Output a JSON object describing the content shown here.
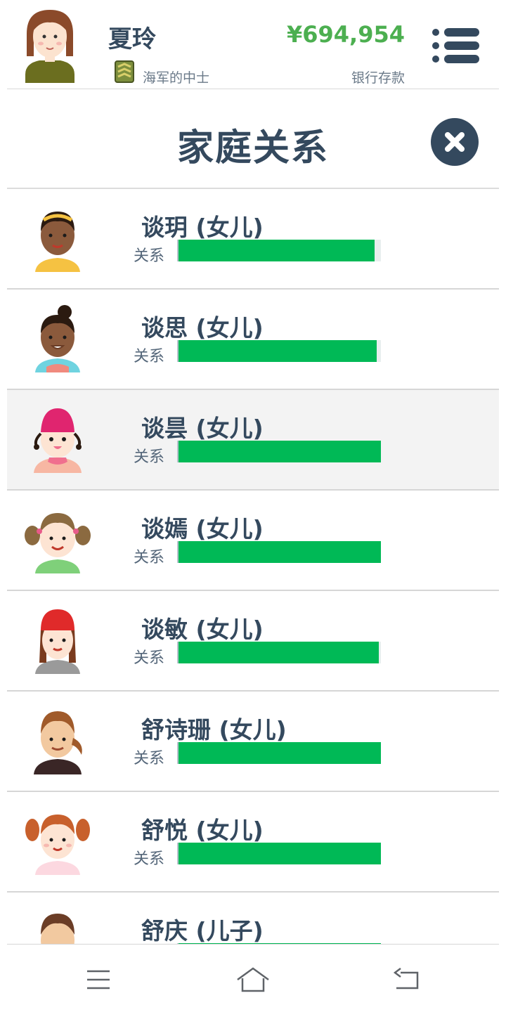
{
  "header": {
    "player_name": "夏玲",
    "rank": "海军的中士",
    "money": "¥694,954",
    "money_label": "银行存款",
    "menu_icon": "list-menu-icon"
  },
  "page": {
    "title": "家庭关系",
    "close_icon": "close-icon"
  },
  "family": [
    {
      "name": "谈玥 (女儿)",
      "relation_label": "关系",
      "relation": 0.97,
      "avatar": "girl-dark-headband-avatar"
    },
    {
      "name": "谈思 (女儿)",
      "relation_label": "关系",
      "relation": 0.98,
      "avatar": "girl-dark-bun-avatar"
    },
    {
      "name": "谈昙 (女儿)",
      "relation_label": "关系",
      "relation": 1.0,
      "avatar": "girl-pink-hat-avatar"
    },
    {
      "name": "谈嫣 (女儿)",
      "relation_label": "关系",
      "relation": 1.0,
      "avatar": "girl-pigtails-avatar"
    },
    {
      "name": "谈敏 (女儿)",
      "relation_label": "关系",
      "relation": 0.99,
      "avatar": "girl-red-beanie-avatar"
    },
    {
      "name": "舒诗珊 (女儿)",
      "relation_label": "关系",
      "relation": 1.0,
      "avatar": "girl-ponytail-avatar"
    },
    {
      "name": "舒悦 (女儿)",
      "relation_label": "关系",
      "relation": 1.0,
      "avatar": "girl-red-pigtails-avatar"
    },
    {
      "name": "舒庆 (儿子)",
      "relation_label": "关系",
      "relation": 1.0,
      "avatar": "boy-avatar"
    }
  ],
  "colors": {
    "text": "#34495e",
    "money": "#4caf50",
    "relation_bar": "#00b956",
    "selected_row": "#f3f3f3"
  },
  "navbar": {
    "icons": [
      "recents-icon",
      "home-icon",
      "back-icon"
    ]
  }
}
